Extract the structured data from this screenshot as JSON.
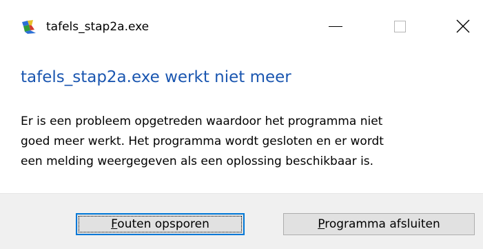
{
  "window": {
    "title": "tafels_stap2a.exe",
    "controls": {
      "minimize": "minimize-icon",
      "maximize": "maximize-icon",
      "close": "close-icon"
    }
  },
  "dialog": {
    "heading": "tafels_stap2a.exe werkt niet meer",
    "message_lines": [
      "Er is een probleem opgetreden waardoor het programma niet",
      "goed meer werkt. Het programma wordt gesloten en er wordt",
      "een melding weergegeven als een oplossing beschikbaar is."
    ]
  },
  "buttons": {
    "debug": {
      "access_key": "F",
      "rest": "outen opsporen"
    },
    "close_program": {
      "access_key": "P",
      "rest": "rogramma afsluiten"
    }
  },
  "colors": {
    "heading": "#1a56b0",
    "footer_bg": "#f0f0f0",
    "focus_border": "#0078d7"
  }
}
